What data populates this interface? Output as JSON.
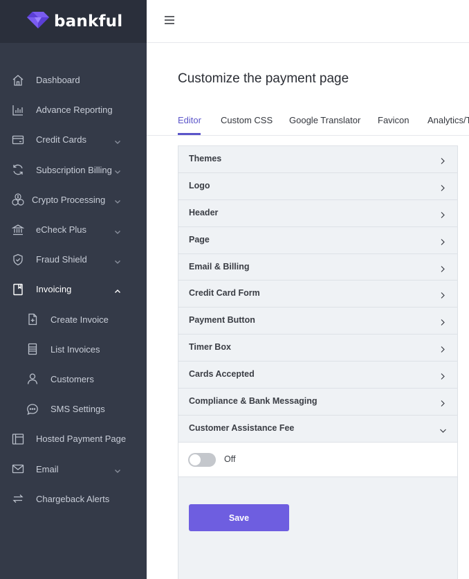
{
  "brand": {
    "name": "bankful"
  },
  "sidebar": {
    "items": [
      {
        "label": "Dashboard",
        "icon": "home-icon",
        "chevron": ""
      },
      {
        "label": "Advance Reporting",
        "icon": "bar-chart-icon",
        "chevron": ""
      },
      {
        "label": "Credit Cards",
        "icon": "credit-card-icon",
        "chevron": "down"
      },
      {
        "label": "Subscription Billing",
        "icon": "refresh-icon",
        "chevron": "down"
      },
      {
        "label": "Crypto Processing",
        "icon": "coins-icon",
        "chevron": "down"
      },
      {
        "label": "eCheck Plus",
        "icon": "bank-icon",
        "chevron": "down"
      },
      {
        "label": "Fraud Shield",
        "icon": "shield-icon",
        "chevron": "down"
      },
      {
        "label": "Invoicing",
        "icon": "bookmark-icon",
        "chevron": "up"
      },
      {
        "label": "Create Invoice",
        "icon": "file-plus-icon",
        "chevron": ""
      },
      {
        "label": "List Invoices",
        "icon": "list-icon",
        "chevron": ""
      },
      {
        "label": "Customers",
        "icon": "user-icon",
        "chevron": ""
      },
      {
        "label": "SMS Settings",
        "icon": "chat-icon",
        "chevron": ""
      },
      {
        "label": "Hosted Payment Page",
        "icon": "layout-icon",
        "chevron": ""
      },
      {
        "label": "Email",
        "icon": "mail-icon",
        "chevron": "down"
      },
      {
        "label": "Chargeback Alerts",
        "icon": "arrows-icon",
        "chevron": ""
      }
    ]
  },
  "main": {
    "title": "Customize the payment page",
    "tabs": [
      {
        "label": "Editor"
      },
      {
        "label": "Custom CSS"
      },
      {
        "label": "Google Translator"
      },
      {
        "label": "Favicon"
      },
      {
        "label": "Analytics/T"
      }
    ],
    "sections": [
      {
        "label": "Themes"
      },
      {
        "label": "Logo"
      },
      {
        "label": "Header"
      },
      {
        "label": "Page"
      },
      {
        "label": "Email & Billing"
      },
      {
        "label": "Credit Card Form"
      },
      {
        "label": "Payment Button"
      },
      {
        "label": "Timer Box"
      },
      {
        "label": "Cards Accepted"
      },
      {
        "label": "Compliance & Bank Messaging"
      },
      {
        "label": "Customer Assistance Fee"
      }
    ],
    "fee_toggle": {
      "label": "Off",
      "on": false
    },
    "save_label": "Save"
  },
  "colors": {
    "accent": "#6e5ee0",
    "sidebar_bg": "#343a48",
    "brand_bg": "#2a2f3b",
    "tab_active": "#5b55c9"
  }
}
